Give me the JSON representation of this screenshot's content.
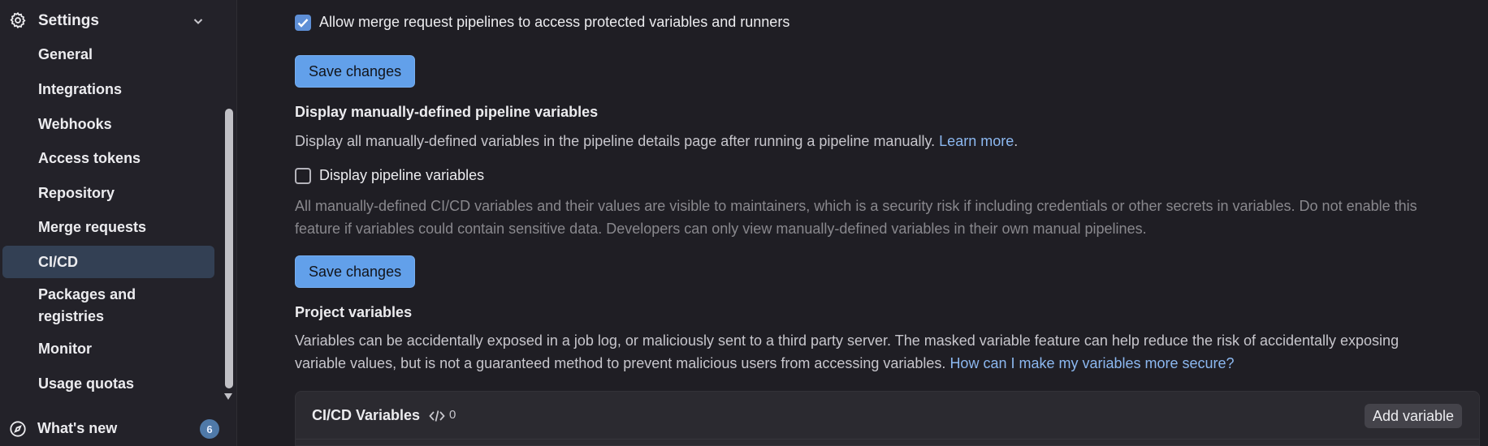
{
  "sidebar": {
    "section_title": "Settings",
    "items": [
      {
        "label": "General"
      },
      {
        "label": "Integrations"
      },
      {
        "label": "Webhooks"
      },
      {
        "label": "Access tokens"
      },
      {
        "label": "Repository"
      },
      {
        "label": "Merge requests"
      },
      {
        "label": "CI/CD",
        "active": true
      },
      {
        "label": "Packages and registries"
      },
      {
        "label": "Monitor"
      },
      {
        "label": "Usage quotas"
      }
    ],
    "whats_new": {
      "label": "What's new",
      "badge": "6"
    }
  },
  "main": {
    "mr_pipelines_checkbox": {
      "label": "Allow merge request pipelines to access protected variables and runners",
      "checked": true
    },
    "save_button_1": "Save changes",
    "display_vars": {
      "heading": "Display manually-defined pipeline variables",
      "description": "Display all manually-defined variables in the pipeline details page after running a pipeline manually.",
      "learn_more": "Learn more",
      "learn_more_suffix": ".",
      "checkbox_label": "Display pipeline variables",
      "checked": false,
      "help_line1": "All manually-defined CI/CD variables and their values are visible to maintainers, which is a security risk if including credentials or other secrets in variables. Do not enable this",
      "help_line2": "feature if variables could contain sensitive data. Developers can only view manually-defined variables in their own manual pipelines."
    },
    "save_button_2": "Save changes",
    "project_variables": {
      "heading": "Project variables",
      "desc_line1": "Variables can be accidentally exposed in a job log, or maliciously sent to a third party server. The masked variable feature can help reduce the risk of accidentally exposing",
      "desc_line2": "variable values, but is not a guaranteed method to prevent malicious users from accessing variables.",
      "secure_link": "How can I make my variables more secure?"
    },
    "cicd_variables_panel": {
      "title": "CI/CD Variables",
      "count": "0",
      "add_button": "Add variable"
    }
  },
  "colors": {
    "accent": "#62a0ea",
    "link": "#8cb8f0",
    "active_nav": "#334054",
    "background": "#1f1e24"
  }
}
